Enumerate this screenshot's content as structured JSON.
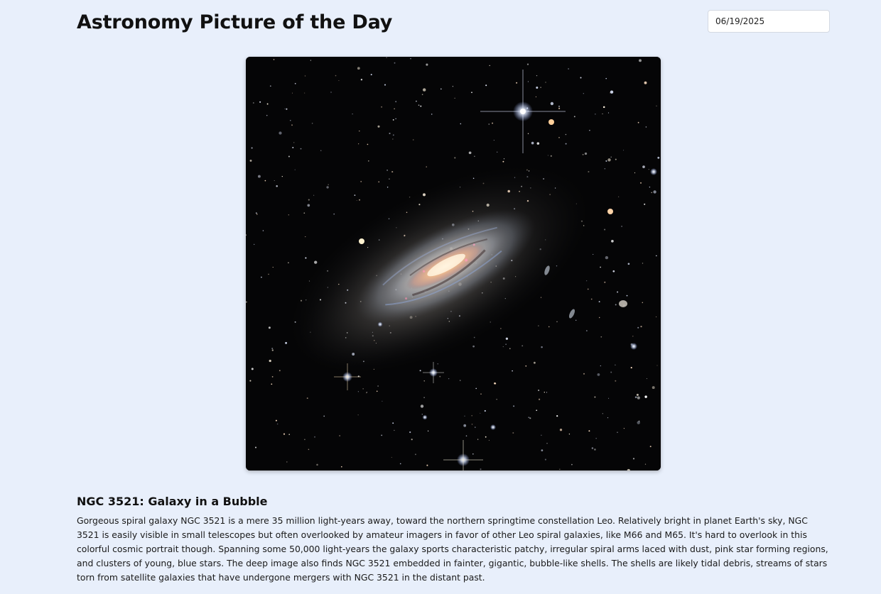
{
  "header": {
    "title": "Astronomy Picture of the Day",
    "date_value": "06/19/2025"
  },
  "image": {
    "icon": "galaxy-photo",
    "subject": "spiral galaxy NGC 3521 with surrounding stars"
  },
  "apod": {
    "title": "NGC 3521: Galaxy in a Bubble",
    "explanation": "Gorgeous spiral galaxy NGC 3521 is a mere 35 million light-years away, toward the northern springtime constellation Leo. Relatively bright in planet Earth's sky, NGC 3521 is easily visible in small telescopes but often overlooked by amateur imagers in favor of other Leo spiral galaxies, like M66 and M65. It's hard to overlook in this colorful cosmic portrait though. Spanning some 50,000 light-years the galaxy sports characteristic patchy, irregular spiral arms laced with dust, pink star forming regions, and clusters of young, blue stars. The deep image also finds NGC 3521 embedded in fainter, gigantic, bubble-like shells. The shells are likely tidal debris, streams of stars torn from satellite galaxies that have undergone mergers with NGC 3521 in the distant past."
  },
  "colors": {
    "page_background": "#e8effb",
    "input_border": "#d4d9e2",
    "text": "#111111"
  }
}
